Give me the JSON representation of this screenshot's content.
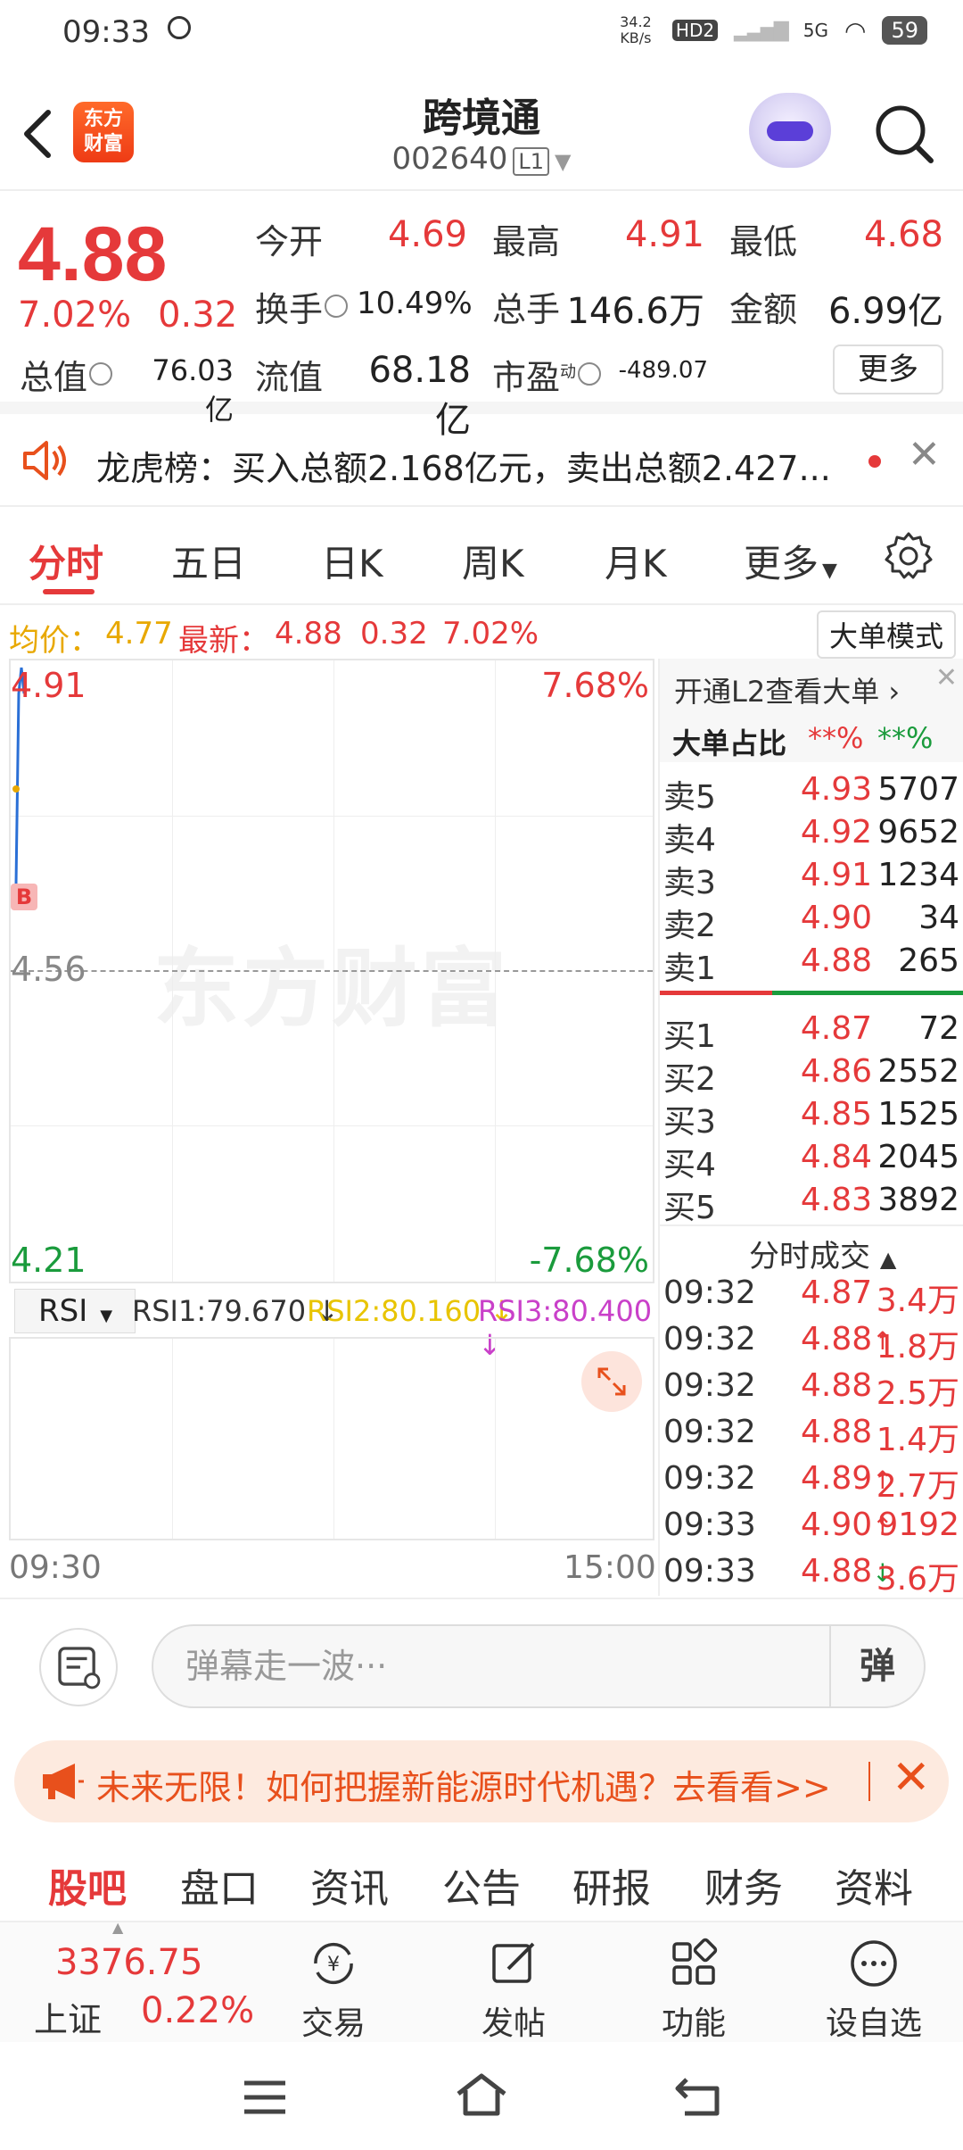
{
  "status": {
    "time": "09:33",
    "net_speed": "34.2 KB/s",
    "hd": "HD2",
    "signal": "5G",
    "battery": "59"
  },
  "header": {
    "logo": "东方财富",
    "name": "跨境通",
    "code": "002640",
    "level": "L1"
  },
  "quote": {
    "price": "4.88",
    "pct": "7.02%",
    "change": "0.32",
    "open_label": "今开",
    "open": "4.69",
    "high_label": "最高",
    "high": "4.91",
    "low_label": "最低",
    "low": "4.68",
    "turnover_label": "换手",
    "turnover": "10.49%",
    "volume_label": "总手",
    "volume": "146.6万",
    "amount_label": "金额",
    "amount": "6.99亿",
    "mcap_label": "总值",
    "mcap": "76.03亿",
    "float_label": "流值",
    "float_cap": "68.18亿",
    "pe_label": "市盈",
    "pe_sup": "动",
    "pe": "-489.07",
    "more": "更多"
  },
  "notice": {
    "text": "龙虎榜：买入总额2.168亿元，卖出总额2.427..."
  },
  "tabs": [
    "分时",
    "五日",
    "日K",
    "周K",
    "月K",
    "更多"
  ],
  "avgbar": {
    "avg_label": "均价：",
    "avg": "4.77",
    "latest_label": "最新：",
    "latest": "4.88",
    "chg": "0.32",
    "pct": "7.02%",
    "mode_btn": "大单模式"
  },
  "chart": {
    "watermark": "东方财富",
    "y_top": "4.91",
    "y_mid": "4.56",
    "y_bottom": "4.21",
    "pct_top": "7.68%",
    "pct_bottom": "-7.68%",
    "b_mark": "B",
    "time_start": "09:30",
    "time_end": "15:00"
  },
  "chart_data": {
    "type": "line",
    "ylim": [
      4.21,
      4.91
    ],
    "series": [
      {
        "values": [
          4.66,
          4.88,
          4.91,
          4.88
        ]
      }
    ]
  },
  "rsi": {
    "select": "RSI",
    "rsi1": "RSI1:79.670",
    "rsi2": "RSI2:80.160",
    "rsi3": "RSI3:80.400",
    "color1": "#333333",
    "color2": "#e8c400",
    "color3": "#c940c9"
  },
  "book": {
    "l2_link": "开通L2查看大单",
    "ratio_label": "大单占比",
    "ratio_buy": "**%",
    "ratio_sell": "**%",
    "sells": [
      {
        "label": "卖5",
        "price": "4.93",
        "vol": "5707"
      },
      {
        "label": "卖4",
        "price": "4.92",
        "vol": "9652"
      },
      {
        "label": "卖3",
        "price": "4.91",
        "vol": "1234"
      },
      {
        "label": "卖2",
        "price": "4.90",
        "vol": "34"
      },
      {
        "label": "卖1",
        "price": "4.88",
        "vol": "265"
      }
    ],
    "buys": [
      {
        "label": "买1",
        "price": "4.87",
        "vol": "72"
      },
      {
        "label": "买2",
        "price": "4.86",
        "vol": "2552"
      },
      {
        "label": "买3",
        "price": "4.85",
        "vol": "1525"
      },
      {
        "label": "买4",
        "price": "4.84",
        "vol": "2045"
      },
      {
        "label": "买5",
        "price": "4.83",
        "vol": "3892"
      }
    ],
    "ticks_label": "分时成交",
    "ticks": [
      {
        "time": "09:32",
        "price": "4.87",
        "dir": "",
        "vol": "3.4万"
      },
      {
        "time": "09:32",
        "price": "4.88",
        "dir": "up",
        "vol": "1.8万"
      },
      {
        "time": "09:32",
        "price": "4.88",
        "dir": "",
        "vol": "2.5万"
      },
      {
        "time": "09:32",
        "price": "4.88",
        "dir": "",
        "vol": "1.4万"
      },
      {
        "time": "09:32",
        "price": "4.89",
        "dir": "up",
        "vol": "2.7万"
      },
      {
        "time": "09:33",
        "price": "4.90",
        "dir": "up",
        "vol": "9192"
      },
      {
        "time": "09:33",
        "price": "4.88",
        "dir": "down",
        "vol": "3.6万"
      }
    ]
  },
  "danmu": {
    "placeholder": "弹幕走一波···",
    "send": "弹"
  },
  "promo": {
    "text": "未来无限！如何把握新能源时代机遇？去看看>>"
  },
  "subtabs": [
    "股吧",
    "盘口",
    "资讯",
    "公告",
    "研报",
    "财务",
    "资料"
  ],
  "bottombar": {
    "index_value": "3376.75",
    "index_name": "上证",
    "index_pct": "0.22%",
    "items": [
      "交易",
      "发帖",
      "功能",
      "设自选"
    ]
  }
}
